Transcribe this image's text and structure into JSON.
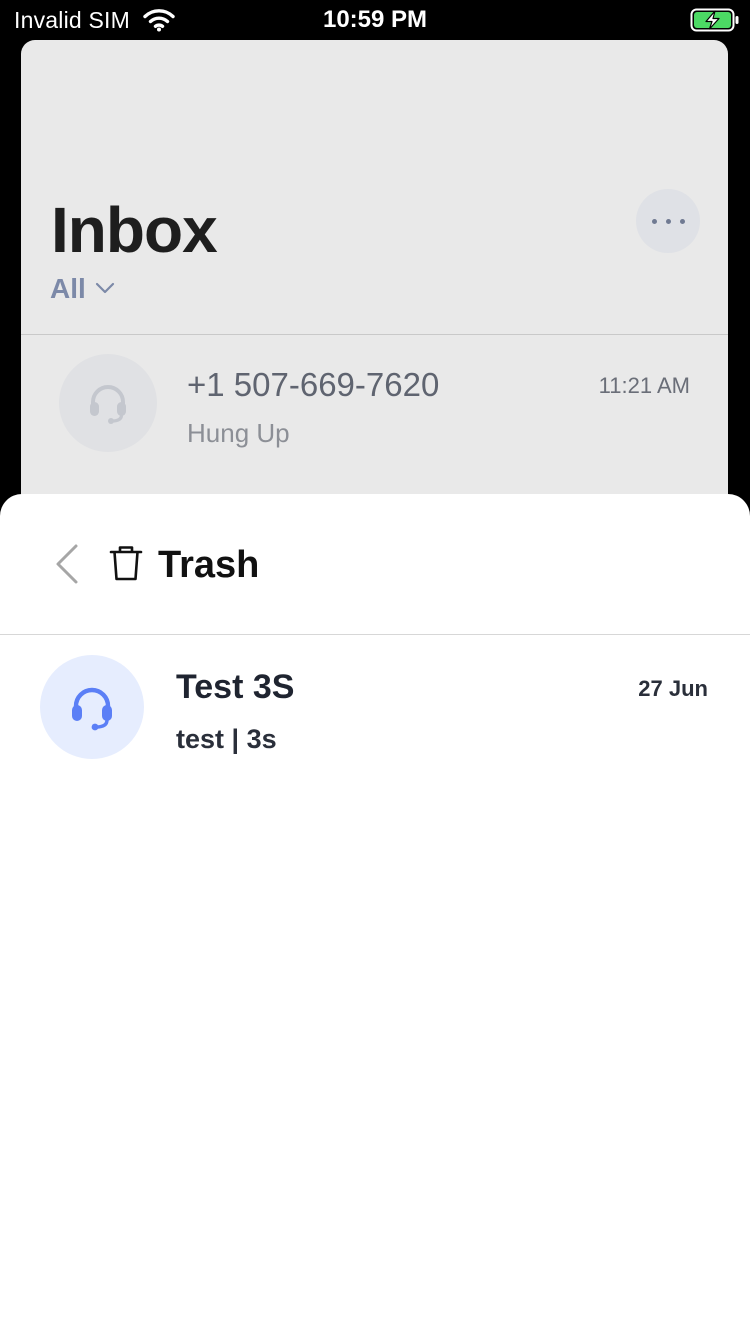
{
  "status_bar": {
    "carrier": "Invalid SIM",
    "time": "10:59 PM",
    "icons": [
      "wifi-icon",
      "battery-charging-icon"
    ],
    "battery_color": "#4cd964"
  },
  "inbox": {
    "title": "Inbox",
    "filter_label": "All",
    "more_icon": "ellipsis-icon",
    "calls": [
      {
        "number": "+1 507-669-7620",
        "status": "Hung Up",
        "time": "11:21 AM",
        "icon": "headset-icon"
      }
    ]
  },
  "trash_sheet": {
    "back_icon": "chevron-left-icon",
    "title_icon": "trash-icon",
    "title": "Trash",
    "items": [
      {
        "name": "Test 3S",
        "detail": "test | 3s",
        "date": "27 Jun",
        "icon": "headset-icon",
        "icon_color": "#5b7ff6"
      }
    ]
  }
}
